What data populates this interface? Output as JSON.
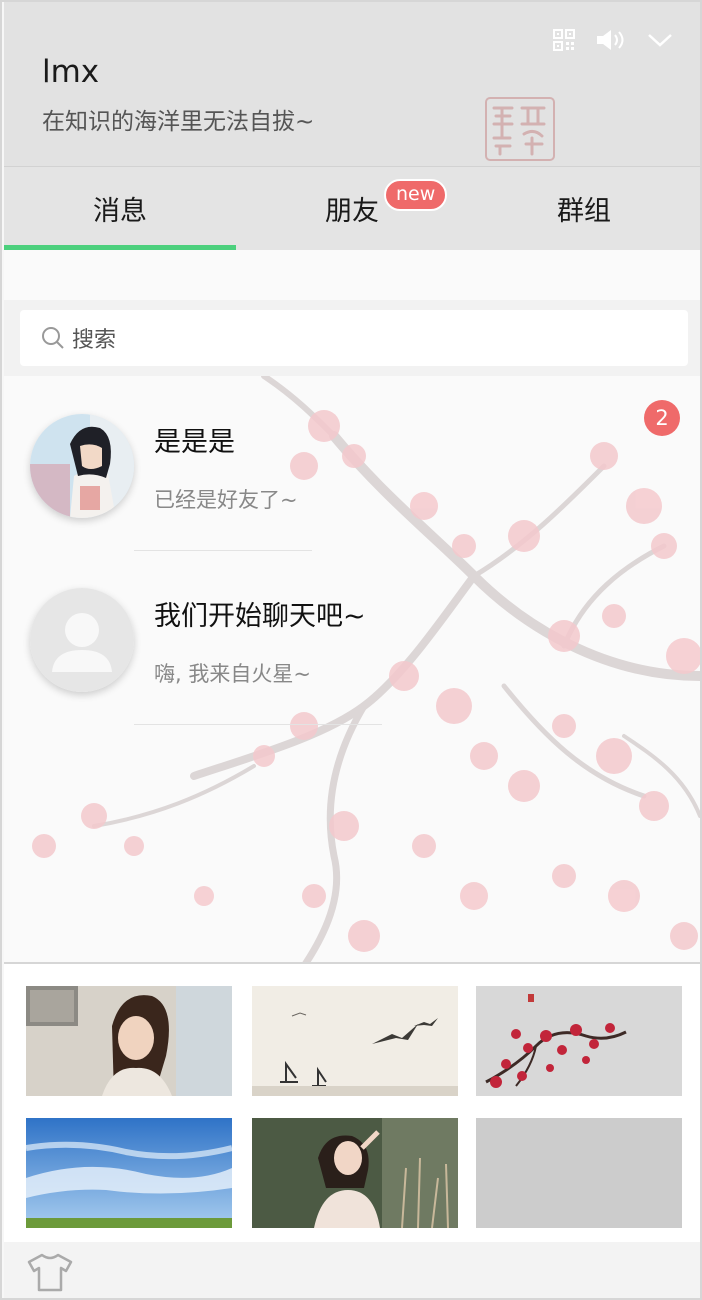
{
  "header": {
    "username": "lmx",
    "signature": "在知识的海洋里无法自拔~",
    "icons": [
      "qrcode-icon",
      "volume-icon",
      "chevron-down-icon"
    ]
  },
  "tabs": [
    {
      "label": "消息",
      "active": true
    },
    {
      "label": "朋友",
      "badge": "new"
    },
    {
      "label": "群组"
    }
  ],
  "search": {
    "placeholder": "搜索"
  },
  "chats": [
    {
      "name": "是是是",
      "preview": "已经是好友了~",
      "unread": "2",
      "avatar": "anime-girl-avatar"
    },
    {
      "name": "我们开始聊天吧~",
      "preview": "嗨, 我来自火星~",
      "avatar": "default-avatar"
    }
  ],
  "skins": [
    "woman-portrait",
    "ink-birds-boats",
    "plum-blossom",
    "blue-sky",
    "girl-in-field",
    "plain-gray"
  ],
  "colors": {
    "accent": "#4cd07d",
    "badge": "#ef6a6a",
    "header_bg": "#e2e2e2"
  }
}
